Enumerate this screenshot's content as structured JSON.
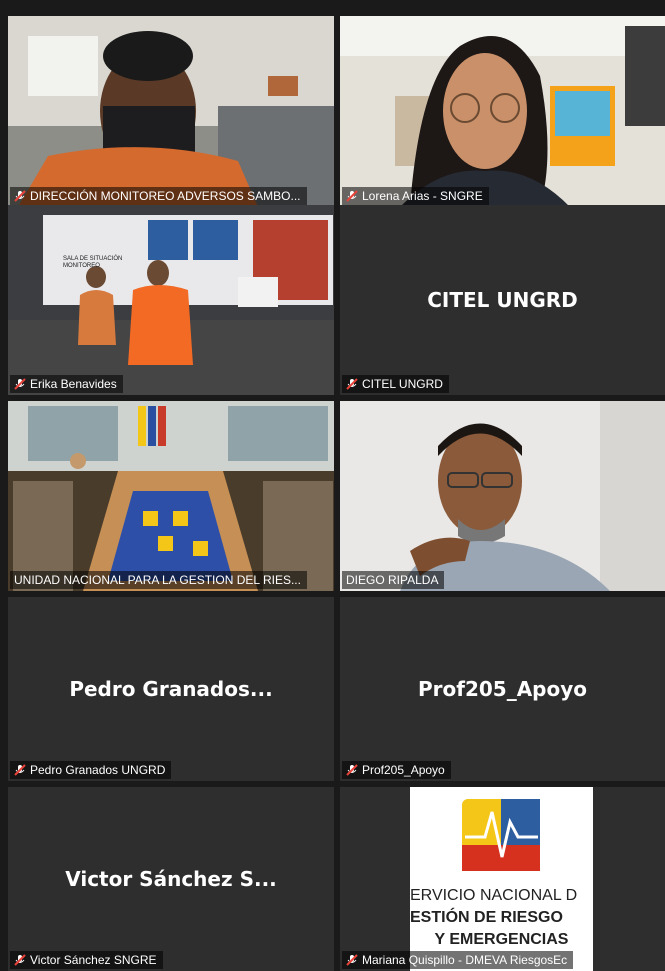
{
  "participants": [
    {
      "label": "DIRECCIÓN MONITOREO ADVERSOS SAMBO...",
      "display": ""
    },
    {
      "label": "Lorena Arias - SNGRE",
      "display": ""
    },
    {
      "label": "Erika Benavides",
      "display": ""
    },
    {
      "label": "CITEL UNGRD",
      "display": "CITEL UNGRD"
    },
    {
      "label": "UNIDAD NACIONAL PARA LA GESTION DEL RIES...",
      "display": ""
    },
    {
      "label": "DIEGO RIPALDA",
      "display": ""
    },
    {
      "label": "Pedro Granados UNGRD",
      "display": "Pedro Granados..."
    },
    {
      "label": "Prof205_Apoyo",
      "display": "Prof205_Apoyo"
    },
    {
      "label": "Victor Sánchez SNGRE",
      "display": "Victor Sánchez S..."
    },
    {
      "label": "Mariana Quispillo - DMEVA RiesgosEc",
      "display": ""
    }
  ],
  "room_sign": {
    "line1": "SALA DE SITUACIÓN",
    "line2": "MONITOREO"
  },
  "logo": {
    "line1": "ERVICIO NACIONAL D",
    "line2": "ESTIÓN DE RIESGO",
    "line3": "Y EMERGENCIAS"
  },
  "colors": {
    "active_border": "#c8e04a",
    "muted_icon": "#e8433a",
    "tile_bg": "#2e2e2e"
  }
}
